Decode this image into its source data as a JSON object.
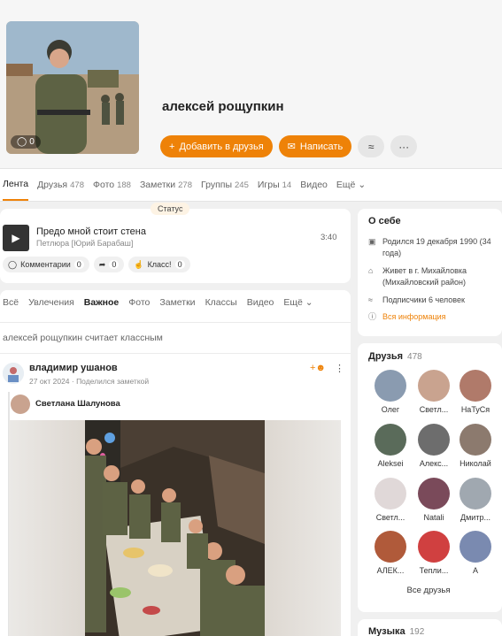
{
  "profile": {
    "name": "алексей рощупкин",
    "photo_count": "0",
    "add_friend_label": "Добавить в друзья",
    "message_label": "Написать"
  },
  "nav": {
    "feed": "Лента",
    "friends": "Друзья",
    "friends_count": "478",
    "photos": "Фото",
    "photos_count": "188",
    "notes": "Заметки",
    "notes_count": "278",
    "groups": "Группы",
    "groups_count": "245",
    "games": "Игры",
    "games_count": "14",
    "video": "Видео",
    "more": "Ещё"
  },
  "status": {
    "tag": "Статус",
    "track_title": "Предо мной стоит стена",
    "track_artist": "Петлюра [Юрий Барабаш]",
    "duration": "3:40",
    "comments_label": "Комментарии",
    "comments_count": "0",
    "shares_count": "0",
    "likes_label": "Класс!",
    "likes_count": "0"
  },
  "feed": {
    "tabs": [
      "Всё",
      "Увлечения",
      "Важное",
      "Фото",
      "Заметки",
      "Классы",
      "Видео",
      "Ещё"
    ],
    "subtitle": "алексей рощупкин считает классным",
    "post_author": "владимир ушанов",
    "post_meta": "27 окт 2024 · Поделился заметкой",
    "shared_author": "Светлана Шалунова"
  },
  "about": {
    "title": "О себе",
    "born": "Родился 19 декабря 1990 (34 года)",
    "lives": "Живет в г. Михайловка (Михайловский район)",
    "followers": "Подписчики 6 человек",
    "all_info": "Вся информация"
  },
  "friends": {
    "title": "Друзья",
    "count": "478",
    "items": [
      {
        "name": "Олег",
        "color": "#8a9bb0"
      },
      {
        "name": "Светл...",
        "color": "#c9a38f"
      },
      {
        "name": "НаТуСя",
        "color": "#b07a6a"
      },
      {
        "name": "Aleksei",
        "color": "#5a6b5a"
      },
      {
        "name": "Алекс...",
        "color": "#6d6d6d"
      },
      {
        "name": "Николай",
        "color": "#8c7a6e"
      },
      {
        "name": "Светл...",
        "color": "#e0d8d8"
      },
      {
        "name": "Natali",
        "color": "#7a4a5a"
      },
      {
        "name": "Дмитр...",
        "color": "#a0a8b0"
      },
      {
        "name": "АЛЕК...",
        "color": "#b05a3a"
      },
      {
        "name": "Тепли...",
        "color": "#d04040"
      },
      {
        "name": "А",
        "color": "#7a8ab0"
      }
    ],
    "all_label": "Все друзья"
  },
  "music": {
    "title": "Музыка",
    "count": "192"
  },
  "colors": {
    "accent": "#ee8208"
  }
}
